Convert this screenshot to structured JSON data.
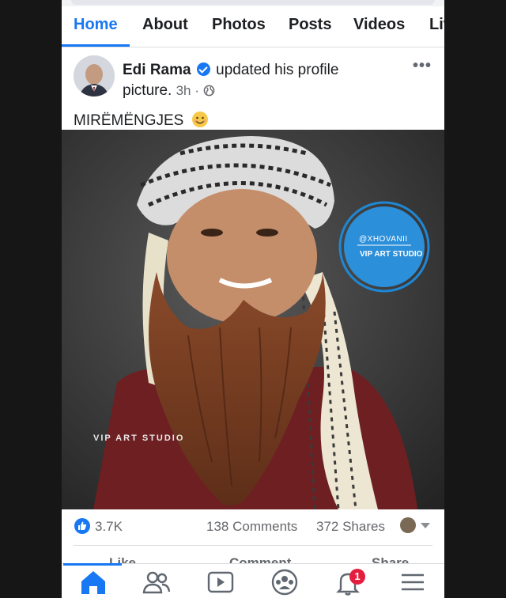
{
  "tabs": [
    "Home",
    "About",
    "Photos",
    "Posts",
    "Videos",
    "Liv"
  ],
  "post": {
    "author": "Edi Rama",
    "action": "updated his profile picture.",
    "time": "3h",
    "more": "•••",
    "caption": "MIRËMËNGJES",
    "photo_watermark": "VIP ART STUDIO",
    "badge_handle": "@XHOVANII",
    "badge_studio": "VIP ART STUDIO"
  },
  "stats": {
    "reactions": "3.7K",
    "comments": "138 Comments",
    "shares": "372 Shares"
  },
  "actions": [
    "Like",
    "Comment",
    "Share"
  ],
  "bottom_nav": {
    "items": [
      "home-icon",
      "friends-icon",
      "video-icon",
      "groups-icon",
      "notifications-icon",
      "menu-icon"
    ],
    "notification_count": "1"
  },
  "colors": {
    "accent": "#1877f2",
    "badge": "#e41e3f"
  }
}
